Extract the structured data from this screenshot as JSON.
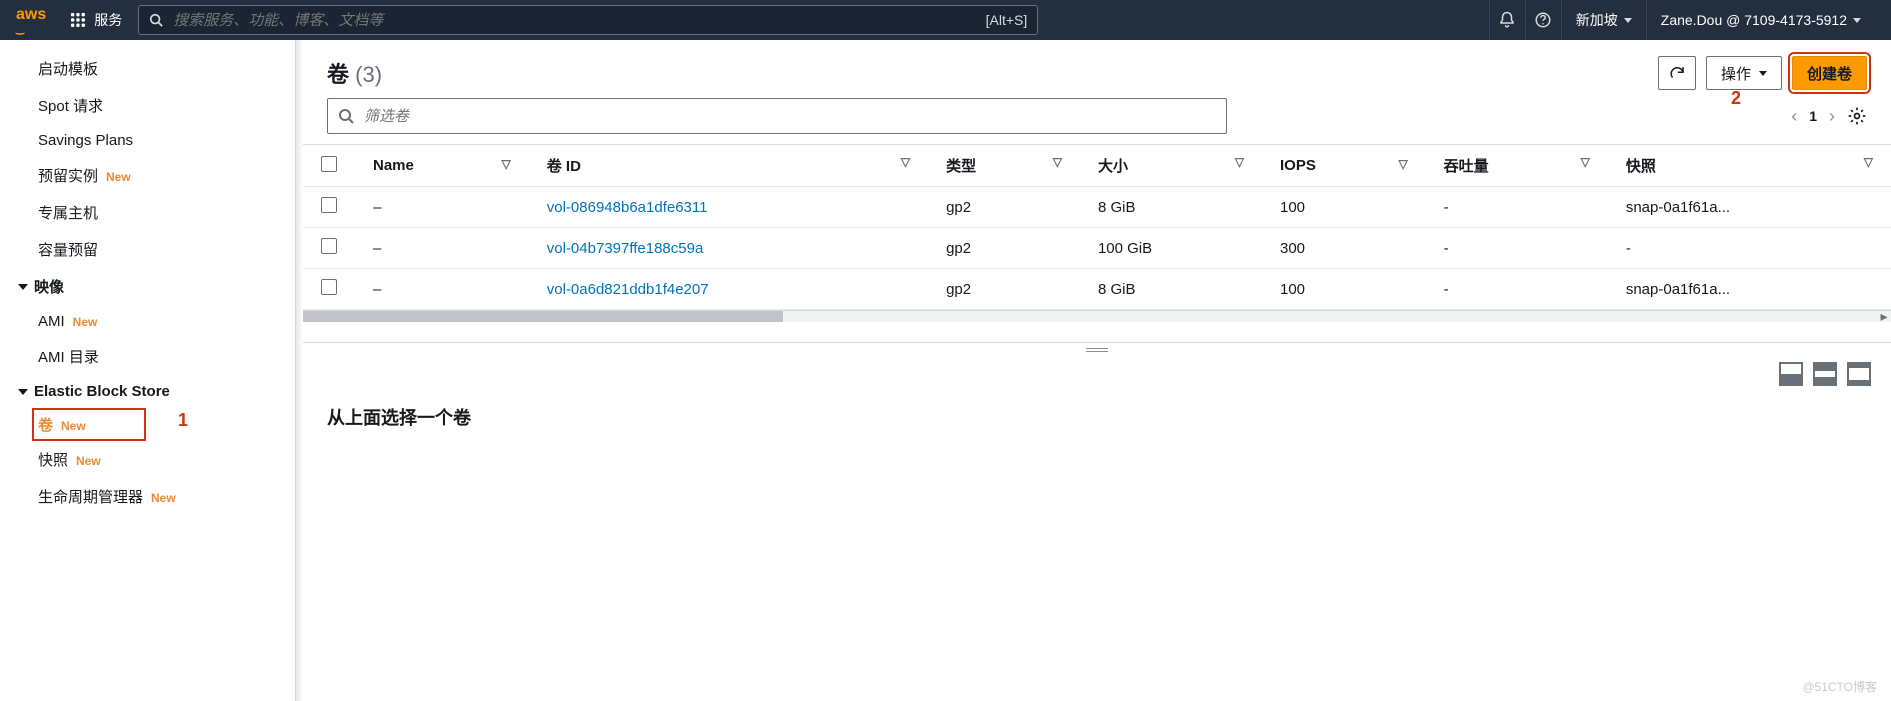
{
  "topbar": {
    "services": "服务",
    "search_placeholder": "搜索服务、功能、博客、文档等",
    "search_hotkey": "[Alt+S]",
    "region": "新加坡",
    "account": "Zane.Dou @ 7109-4173-5912"
  },
  "sidebar": {
    "items": [
      {
        "label": "启动模板",
        "type": "item"
      },
      {
        "label": "Spot 请求",
        "type": "item"
      },
      {
        "label": "Savings Plans",
        "type": "item"
      },
      {
        "label": "预留实例",
        "type": "item",
        "badge": "New"
      },
      {
        "label": "专属主机",
        "type": "item"
      },
      {
        "label": "容量预留",
        "type": "item"
      },
      {
        "label": "映像",
        "type": "section"
      },
      {
        "label": "AMI",
        "type": "item",
        "badge": "New"
      },
      {
        "label": "AMI 目录",
        "type": "item"
      },
      {
        "label": "Elastic Block Store",
        "type": "section"
      },
      {
        "label": "卷",
        "type": "item",
        "badge": "New",
        "active": true
      },
      {
        "label": "快照",
        "type": "item",
        "badge": "New"
      },
      {
        "label": "生命周期管理器",
        "type": "item",
        "badge": "New"
      }
    ],
    "annotation1": "1"
  },
  "main": {
    "title": "卷",
    "count": "(3)",
    "actions": {
      "refresh": "刷新",
      "ops": "操作",
      "create": "创建卷"
    },
    "annotation2": "2",
    "filter_placeholder": "筛选卷",
    "pager_page": "1",
    "columns": [
      "Name",
      "卷 ID",
      "类型",
      "大小",
      "IOPS",
      "吞吐量",
      "快照"
    ],
    "rows": [
      {
        "name": "–",
        "vol": "vol-086948b6a1dfe6311",
        "type": "gp2",
        "size": "8 GiB",
        "iops": "100",
        "throughput": "-",
        "snapshot": "snap-0a1f61a..."
      },
      {
        "name": "–",
        "vol": "vol-04b7397ffe188c59a",
        "type": "gp2",
        "size": "100 GiB",
        "iops": "300",
        "throughput": "-",
        "snapshot": "-"
      },
      {
        "name": "–",
        "vol": "vol-0a6d821ddb1f4e207",
        "type": "gp2",
        "size": "8 GiB",
        "iops": "100",
        "throughput": "-",
        "snapshot": "snap-0a1f61a..."
      }
    ],
    "detail_msg": "从上面选择一个卷"
  },
  "watermark": "@51CTO博客"
}
